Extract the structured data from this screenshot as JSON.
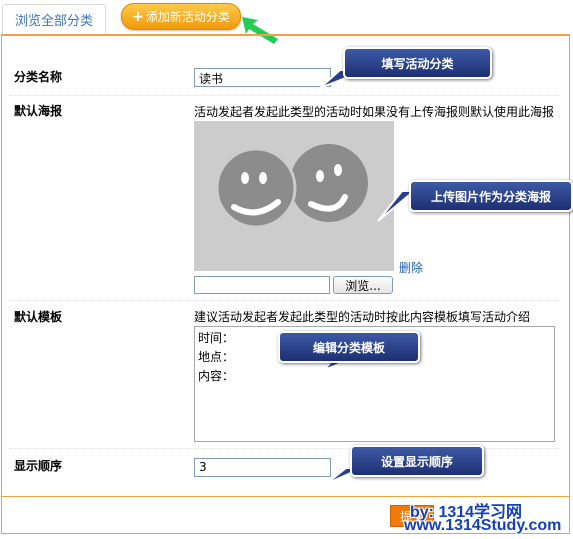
{
  "tabs": {
    "browse_label": "浏览全部分类",
    "add_label": "添加新活动分类",
    "add_icon": "plus-icon"
  },
  "form": {
    "name_label": "分类名称",
    "name_value": "读书",
    "poster_label": "默认海报",
    "poster_hint": "活动发起者发起此类型的活动时如果没有上传海报则默认使用此海报",
    "delete_link": "删除",
    "browse_button": "浏览...",
    "template_label": "默认模板",
    "template_hint": "建议活动发起者发起此类型的活动时按此内容模板填写活动介绍",
    "template_lines": [
      "时间：",
      "地点：",
      "内容："
    ],
    "order_label": "显示顺序",
    "order_value": "3",
    "submit_label": "提交"
  },
  "callouts": {
    "fill_category": "填写活动分类",
    "upload_poster": "上传图片作为分类海报",
    "edit_template": "编辑分类模板",
    "set_order": "设置显示顺序"
  },
  "watermark": {
    "line1": "by: 1314学习网",
    "line2": "www.1314Study.com"
  },
  "colors": {
    "accent_orange": "#f29a09",
    "panel_border": "#f2a142",
    "callout_blue": "#2a3f8c",
    "link_blue": "#1a5fb4",
    "watermark_blue": "#1440b8",
    "arrow_green": "#22cc55"
  }
}
